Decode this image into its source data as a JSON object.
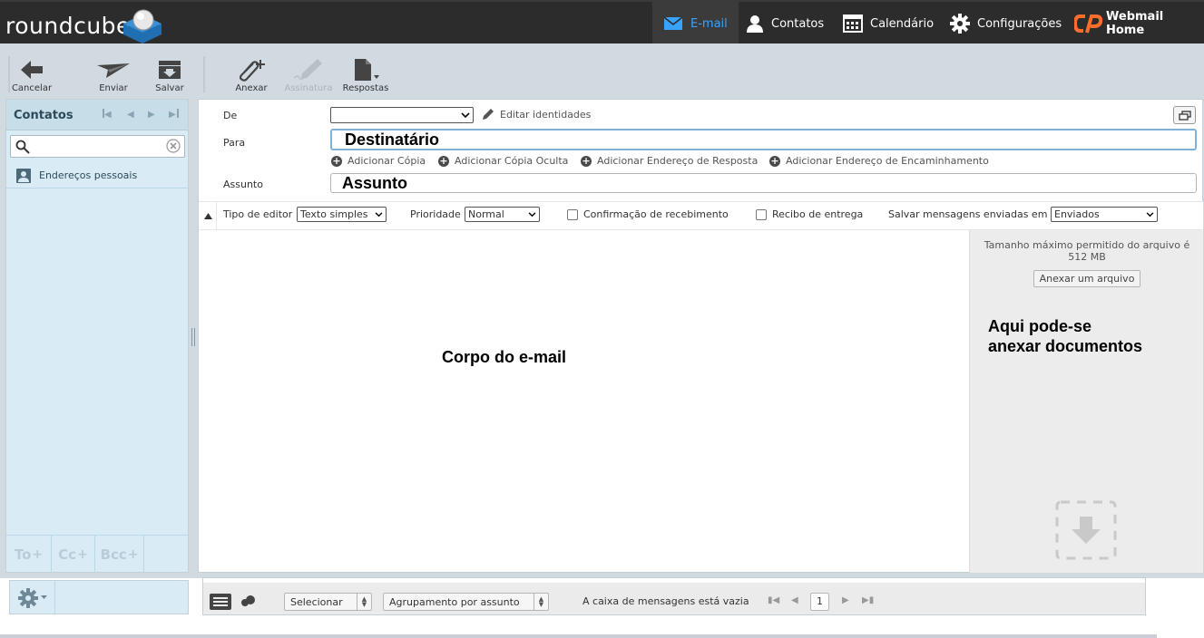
{
  "brand": {
    "logo_text": "roundcube"
  },
  "nav": {
    "items": [
      {
        "label": "E-mail",
        "icon": "envelope-icon"
      },
      {
        "label": "Contatos",
        "icon": "person-icon"
      },
      {
        "label": "Calendário",
        "icon": "calendar-icon"
      },
      {
        "label": "Configurações",
        "icon": "gear-icon"
      },
      {
        "label": "Webmail Home",
        "icon": "cpanel-logo-icon"
      }
    ],
    "active": "E-mail",
    "accent_color": "#37a3ff"
  },
  "toolbar": {
    "cancel_label": "Cancelar",
    "send_label": "Enviar",
    "save_label": "Salvar",
    "attach_label": "Anexar",
    "signature_label": "Assinatura",
    "responses_label": "Respostas"
  },
  "contacts": {
    "title": "Contatos",
    "search_value": "",
    "items": [
      {
        "label": "Endereços pessoais"
      }
    ],
    "recipient_buttons": {
      "to": "To",
      "cc": "Cc",
      "bcc": "Bcc"
    }
  },
  "compose": {
    "from_label": "De",
    "from_value": "",
    "edit_identities_label": "Editar identidades",
    "to_label": "Para",
    "to_value": "Destinatário",
    "add_cc_label": "Adicionar Cópia",
    "add_bcc_label": "Adicionar Cópia Oculta",
    "add_reply_to_label": "Adicionar Endereço de Resposta",
    "add_followup_label": "Adicionar Endereço de Encaminhamento",
    "subject_label": "Assunto",
    "subject_value": "Assunto",
    "editor_type_label": "Tipo de editor",
    "editor_type_value": "Texto simples",
    "priority_label": "Prioridade",
    "priority_value": "Normal",
    "read_receipt_label": "Confirmação de recebimento",
    "delivery_receipt_label": "Recibo de entrega",
    "save_sent_label": "Salvar mensagens enviadas em",
    "save_sent_value": "Enviados",
    "body_annotation": "Corpo do e-mail"
  },
  "attachments": {
    "max_size_text": "Tamanho máximo permitido do arquivo é 512 MB",
    "attach_button_label": "Anexar um arquivo",
    "annotation_line1": "Aqui pode-se",
    "annotation_line2": "anexar documentos"
  },
  "message_list": {
    "select_label": "Selecionar",
    "threading_label": "Agrupamento por assunto",
    "status_text": "A caixa de mensagens está vazia",
    "page_number": "1"
  }
}
